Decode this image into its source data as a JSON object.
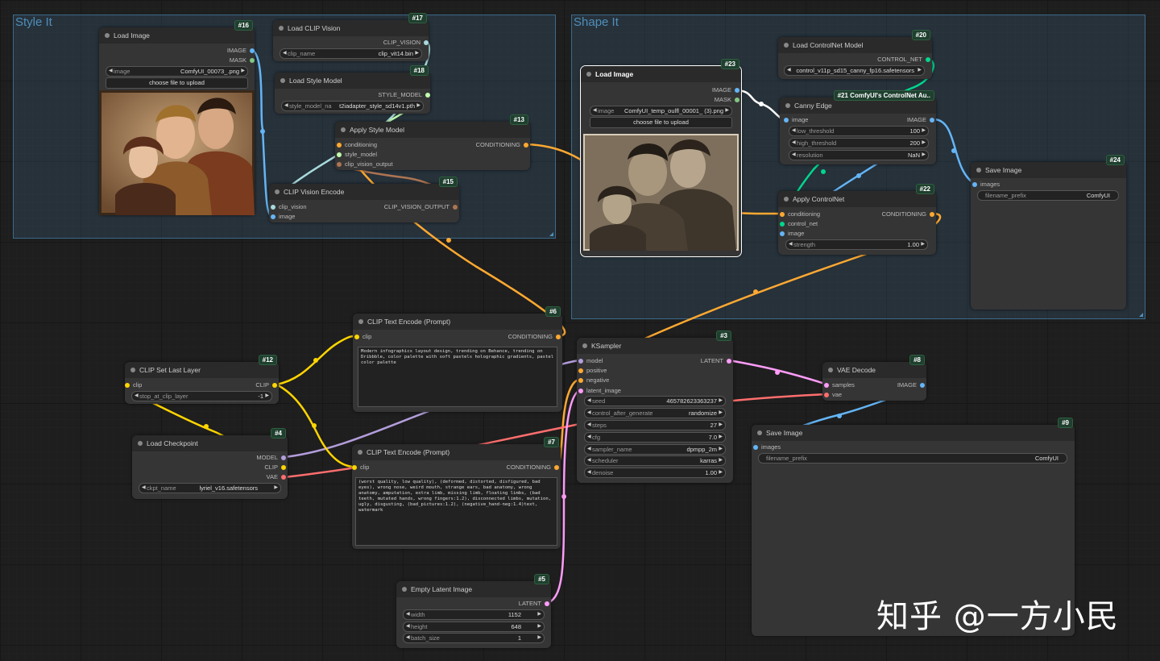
{
  "groups": {
    "style_it": "Style It",
    "shape_it": "Shape It"
  },
  "colors": {
    "clip": "#ffd500",
    "conditioning": "#ffa931",
    "model": "#b39ddb",
    "vae": "#ff6e6e",
    "latent": "#ff9cf9",
    "image": "#64b5f6",
    "mask": "#81c784",
    "control_net": "#00d78d",
    "clip_vision": "#a8dadc",
    "style_model": "#c2ffae",
    "clip_vision_output": "#ad7452"
  },
  "nodes": {
    "n16": {
      "title": "Load Image",
      "id": "#16",
      "out_image": "IMAGE",
      "out_mask": "MASK",
      "w_image_label": "image",
      "w_image_value": "ComfyUI_00073_.png",
      "upload": "choose file to upload"
    },
    "n17": {
      "title": "Load CLIP Vision",
      "id": "#17",
      "out": "CLIP_VISION",
      "w_label": "clip_name",
      "w_value": "clip_vit14.bin"
    },
    "n18": {
      "title": "Load Style Model",
      "id": "#18",
      "out": "STYLE_MODEL",
      "w_label": "style_model_na",
      "w_value": "t2iadapter_style_sd14v1.pth"
    },
    "n13": {
      "title": "Apply Style Model",
      "id": "#13",
      "in1": "conditioning",
      "in2": "style_model",
      "in3": "clip_vision_output",
      "out": "CONDITIONING"
    },
    "n15": {
      "title": "CLIP Vision Encode",
      "id": "#15",
      "in1": "clip_vision",
      "in2": "image",
      "out": "CLIP_VISION_OUTPUT"
    },
    "n23": {
      "title": "Load Image",
      "id": "#23",
      "out_image": "IMAGE",
      "out_mask": "MASK",
      "w_image_label": "image",
      "w_image_value": "ComfyUI_temp_oulfl_00001_ (3).png",
      "upload": "choose file to upload"
    },
    "n20": {
      "title": "Load ControlNet Model",
      "id": "#20",
      "out": "CONTROL_NET",
      "w_value": "control_v11p_sd15_canny_fp16.safetensors"
    },
    "n21": {
      "title": "Canny Edge",
      "id": "#21 ComfyUI's ControlNet Au..",
      "in1": "image",
      "out": "IMAGE",
      "w1_label": "low_threshold",
      "w1_value": "100",
      "w2_label": "high_threshold",
      "w2_value": "200",
      "w3_label": "resolution",
      "w3_value": "NaN"
    },
    "n22": {
      "title": "Apply ControlNet",
      "id": "#22",
      "in1": "conditioning",
      "in2": "control_net",
      "in3": "image",
      "out": "CONDITIONING",
      "w_label": "strength",
      "w_value": "1.00"
    },
    "n24": {
      "title": "Save Image",
      "id": "#24",
      "in1": "images",
      "w_label": "filename_prefix",
      "w_value": "ComfyUI"
    },
    "n12": {
      "title": "CLIP Set Last Layer",
      "id": "#12",
      "in1": "clip",
      "out": "CLIP",
      "w_label": "stop_at_clip_layer",
      "w_value": "-1"
    },
    "n4": {
      "title": "Load Checkpoint",
      "id": "#4",
      "out1": "MODEL",
      "out2": "CLIP",
      "out3": "VAE",
      "w_label": "ckpt_name",
      "w_value": "lyriel_v16.safetensors"
    },
    "n6": {
      "title": "CLIP Text Encode (Prompt)",
      "id": "#6",
      "in1": "clip",
      "out": "CONDITIONING",
      "text": "Modern infographics layout design, trending on Behance, trending on Dribbble, color palette with soft pastels holographic gradients, pastel color palette"
    },
    "n7": {
      "title": "CLIP Text Encode (Prompt)",
      "id": "#7",
      "in1": "clip",
      "out": "CONDITIONING",
      "text": "(worst quality, low quality), (deformed, distorted, disfigured, bad eyes), wrong nose, weird mouth, strange ears, bad anatomy, wrong anatomy, amputation, extra limb, missing limb, floating limbs, (bad teeth, mutated hands, wrong fingers:1.2), disconnected limbs, mutation, ugly, disgusting, (bad_pictures:1.2), (negative_hand-neg:1.4)text, watermark"
    },
    "n3": {
      "title": "KSampler",
      "id": "#3",
      "in1": "model",
      "in2": "positive",
      "in3": "negative",
      "in4": "latent_image",
      "out": "LATENT",
      "widgets": [
        {
          "label": "seed",
          "value": "465782623363237"
        },
        {
          "label": "control_after_generate",
          "value": "randomize"
        },
        {
          "label": "steps",
          "value": "27"
        },
        {
          "label": "cfg",
          "value": "7.0"
        },
        {
          "label": "sampler_name",
          "value": "dpmpp_2m"
        },
        {
          "label": "scheduler",
          "value": "karras"
        },
        {
          "label": "denoise",
          "value": "1.00"
        }
      ]
    },
    "n8": {
      "title": "VAE Decode",
      "id": "#8",
      "in1": "samples",
      "in2": "vae",
      "out": "IMAGE"
    },
    "n9": {
      "title": "Save Image",
      "id": "#9",
      "in1": "images",
      "w_label": "filename_prefix",
      "w_value": "ComfyUI"
    },
    "n5": {
      "title": "Empty Latent Image",
      "id": "#5",
      "out": "LATENT",
      "widgets": [
        {
          "label": "width",
          "value": "1152"
        },
        {
          "label": "height",
          "value": "648"
        },
        {
          "label": "batch_size",
          "value": "1"
        }
      ]
    }
  },
  "watermark": "知乎 @一方小民"
}
